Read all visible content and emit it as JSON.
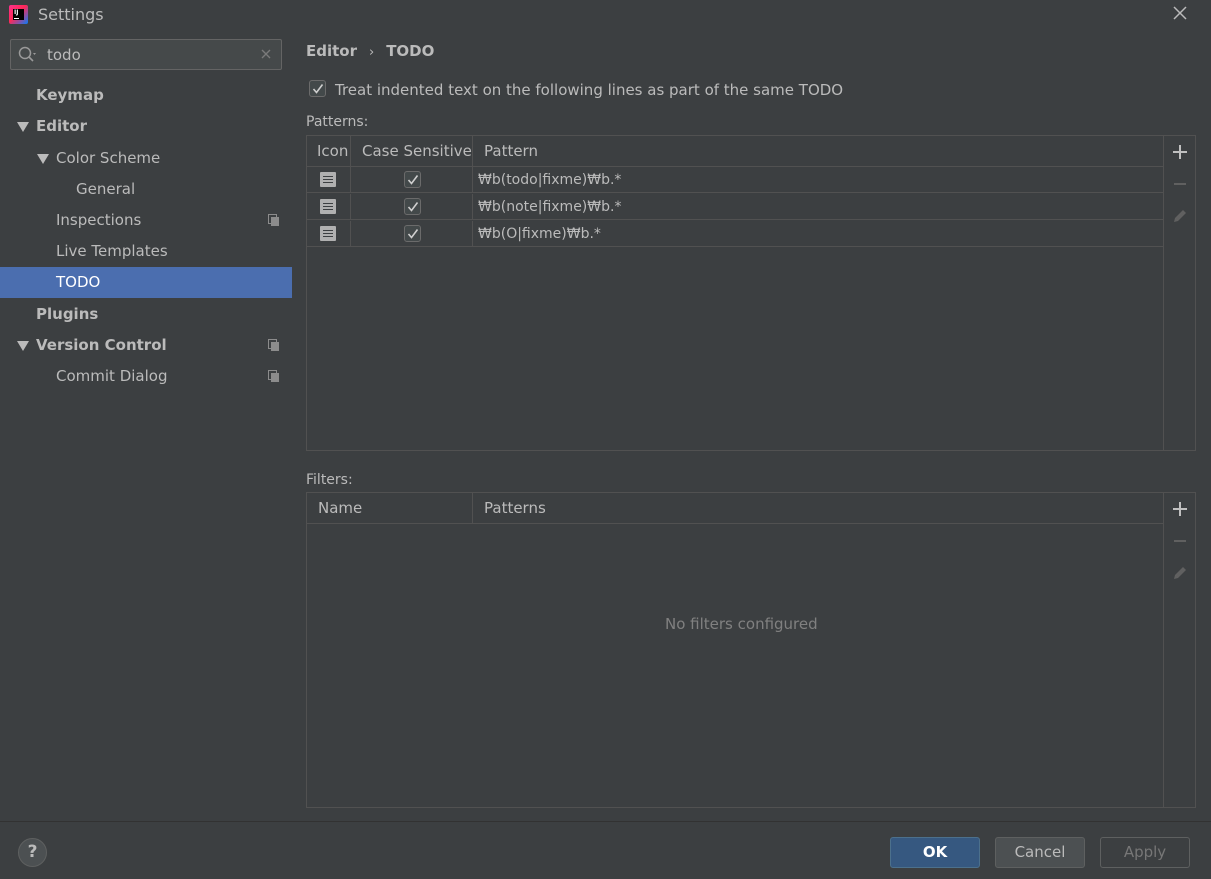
{
  "window": {
    "title": "Settings"
  },
  "search": {
    "value": "todo"
  },
  "sidebar": {
    "items": [
      {
        "label": "Keymap"
      },
      {
        "label": "Editor"
      },
      {
        "label": "Color Scheme"
      },
      {
        "label": "General"
      },
      {
        "label": "Inspections"
      },
      {
        "label": "Live Templates"
      },
      {
        "label": "TODO"
      },
      {
        "label": "Plugins"
      },
      {
        "label": "Version Control"
      },
      {
        "label": "Commit Dialog"
      }
    ]
  },
  "breadcrumb": {
    "parent": "Editor",
    "separator": "›",
    "current": "TODO"
  },
  "options": {
    "treat_indented_label": "Treat indented text on the following lines as part of the same TODO",
    "treat_indented_checked": true
  },
  "patterns": {
    "label": "Patterns:",
    "columns": [
      "Icon",
      "Case Sensitive",
      "Pattern"
    ],
    "rows": [
      {
        "case_sensitive": true,
        "pattern": "₩b(todo|fixme)₩b.*"
      },
      {
        "case_sensitive": true,
        "pattern": "₩b(note|fixme)₩b.*"
      },
      {
        "case_sensitive": true,
        "pattern": "₩b(O|fixme)₩b.*"
      }
    ]
  },
  "filters": {
    "label": "Filters:",
    "columns": [
      "Name",
      "Patterns"
    ],
    "empty_text": "No filters configured"
  },
  "footer": {
    "help_label": "?",
    "ok_label": "OK",
    "cancel_label": "Cancel",
    "apply_label": "Apply"
  },
  "colors": {
    "background": "#3c3f41",
    "selection": "#4b6eaf",
    "ok_button": "#365880",
    "text": "#bbbbbb"
  }
}
